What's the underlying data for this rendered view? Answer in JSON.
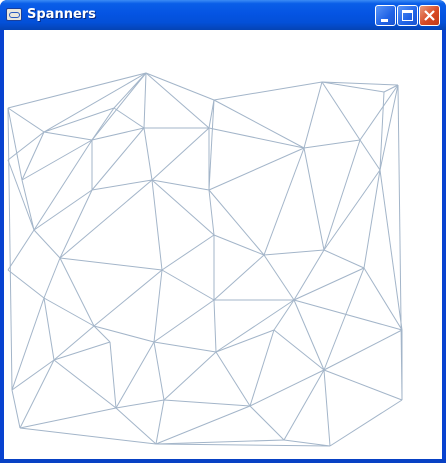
{
  "window": {
    "title": "Spanners",
    "title_icon": "app-window-icon",
    "buttons": [
      "minimize",
      "maximize",
      "close"
    ]
  },
  "colors": {
    "titlebar": "#0554e3",
    "client_background": "#ffffff",
    "edge": "#a3b5c9",
    "close_button": "#d84a25"
  }
}
